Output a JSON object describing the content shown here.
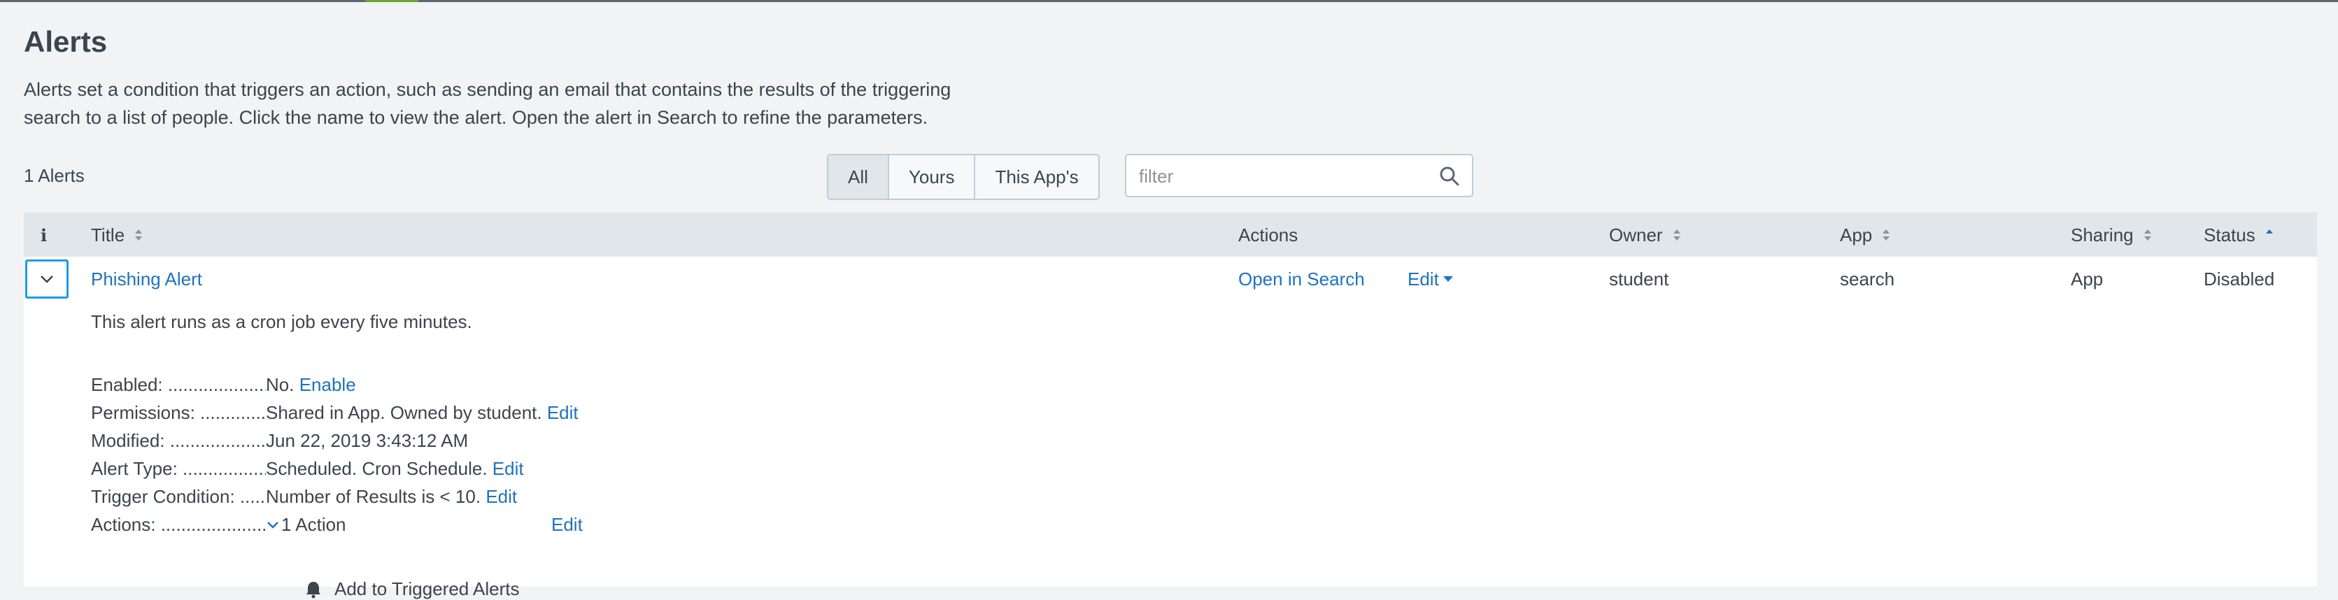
{
  "header": {
    "title": "Alerts",
    "description_line1": "Alerts set a condition that triggers an action, such as sending an email that contains the results of the triggering",
    "description_line2": "search to a list of people. Click the name to view the alert. Open the alert in Search to refine the parameters."
  },
  "toolbar": {
    "count": "1 Alerts",
    "filters": [
      {
        "label": "All",
        "active": true
      },
      {
        "label": "Yours",
        "active": false
      },
      {
        "label": "This App's",
        "active": false
      }
    ],
    "filter_placeholder": "filter",
    "filter_value": ""
  },
  "table": {
    "columns": {
      "info": "i",
      "title": "Title",
      "actions": "Actions",
      "owner": "Owner",
      "app": "App",
      "sharing": "Sharing",
      "status": "Status"
    },
    "rows": [
      {
        "title": "Phishing Alert",
        "open_in_search": "Open in Search",
        "edit": "Edit",
        "owner": "student",
        "app": "search",
        "sharing": "App",
        "status": "Disabled"
      }
    ]
  },
  "detail": {
    "summary": "This alert runs as a cron job every five minutes.",
    "enabled": {
      "label": "Enabled: ..........................",
      "value": "No.",
      "link": "Enable"
    },
    "permissions": {
      "label": "Permissions: ....................",
      "value": "Shared in App. Owned by student.",
      "link": "Edit"
    },
    "modified": {
      "label": "Modified: ..........................",
      "value": "Jun 22, 2019 3:43:12 AM"
    },
    "alert_type": {
      "label": "Alert Type: .......................",
      "value": "Scheduled. Cron Schedule.",
      "link": "Edit"
    },
    "trigger_condition": {
      "label": "Trigger Condition: .......",
      "value": "Number of Results is < 10.",
      "link": "Edit"
    },
    "actions": {
      "label": "Actions: ............................",
      "value": "1 Action",
      "link": "Edit",
      "items": [
        "Add to Triggered Alerts"
      ]
    }
  },
  "colors": {
    "link": "#1e73be",
    "focus": "#1a9ee5",
    "accent": "#65a637",
    "header_bg": "#e1e6eb"
  }
}
